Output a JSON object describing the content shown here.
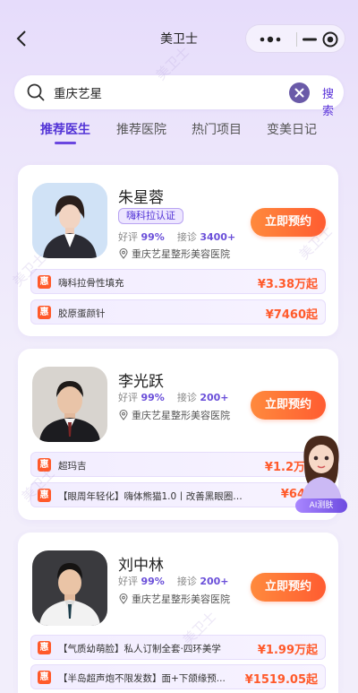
{
  "header": {
    "title": "美卫士"
  },
  "search": {
    "query": "重庆艺星",
    "button_label": "搜索"
  },
  "tabs": [
    "推荐医生",
    "推荐医院",
    "热门项目",
    "变美日记"
  ],
  "doctors": [
    {
      "name": "朱星蓉",
      "badge": "嗨科拉认证",
      "rating_label": "好评",
      "rating": "99%",
      "consult_label": "接诊",
      "consults": "3400+",
      "hospital": "重庆艺星整形美容医院",
      "book_label": "立即预约",
      "items": [
        {
          "tag": "惠",
          "label": "嗨科拉骨性填充",
          "price": "¥3.38万起"
        },
        {
          "tag": "惠",
          "label": "胶原蛋颜针",
          "price": "¥7460起"
        }
      ]
    },
    {
      "name": "李光跃",
      "rating_label": "好评",
      "rating": "99%",
      "consult_label": "接诊",
      "consults": "200+",
      "hospital": "重庆艺星整形美容医院",
      "book_label": "立即预约",
      "items": [
        {
          "tag": "惠",
          "label": "超玛吉",
          "price": "¥1.2万"
        },
        {
          "tag": "惠",
          "label": "【眼周年轻化】嗨体熊猫1.0丨改善黑眼圈泪...",
          "price": "¥64"
        }
      ]
    },
    {
      "name": "刘中林",
      "rating_label": "好评",
      "rating": "99%",
      "consult_label": "接诊",
      "consults": "200+",
      "hospital": "重庆艺星整形美容医院",
      "book_label": "立即预约",
      "items": [
        {
          "tag": "惠",
          "label": "【气质幼萌脸】私人订制全套·四环美学",
          "price": "¥1.99万起"
        },
        {
          "tag": "惠",
          "label": "【半岛超声炮不限发数】面+下颌缘预...",
          "price": "¥1519.05起"
        }
      ]
    }
  ],
  "ai_assistant": {
    "label": "AI测肤"
  },
  "watermark_text": "美卫士",
  "colors": {
    "accent": "#5233d6",
    "price": "#ff5a2b",
    "button": "#ff6a35"
  }
}
